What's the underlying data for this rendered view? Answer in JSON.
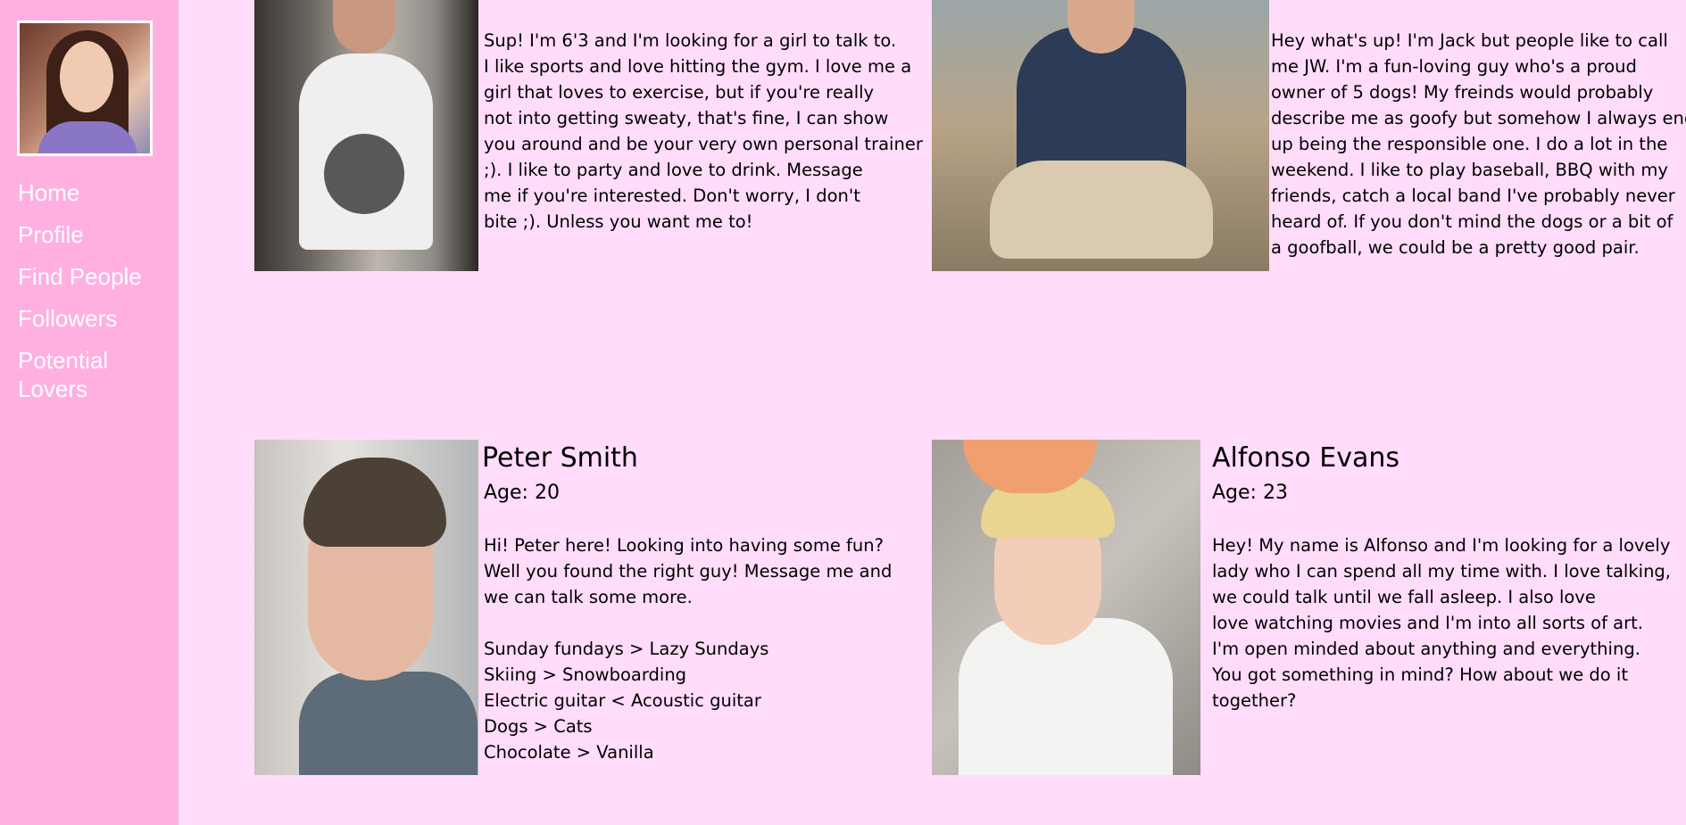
{
  "sidebar": {
    "avatar_icon": "profile-photo",
    "items": [
      {
        "label": "Home"
      },
      {
        "label": "Profile"
      },
      {
        "label": "Find People"
      },
      {
        "label": "Followers"
      },
      {
        "label": "Potential\nLovers"
      }
    ]
  },
  "profiles": [
    {
      "bio": "Sup! I'm 6'3 and I'm looking for a girl to talk to.\nI like sports and love hitting the gym. I love me a\ngirl that loves to exercise, but if you're really\nnot into getting sweaty, that's fine, I can show\nyou around and be your very own personal trainer\n;). I like to party and love to drink. Message\nme if you're interested. Don't worry, I don't\nbite ;). Unless you want me to!"
    },
    {
      "bio": "Hey what's up! I'm Jack but people like to call\nme JW. I'm a fun-loving guy who's a proud\nowner of 5 dogs! My freinds would probably\ndescribe me as goofy but somehow I always end\nup being the responsible one. I do a lot in the\nweekend. I like to play baseball, BBQ with my\nfriends, catch a local band I've probably never\nheard of. If you don't mind the dogs or a bit of\na goofball, we could be a pretty good pair."
    },
    {
      "name": "Peter Smith",
      "age": "Age: 20",
      "bio": "Hi! Peter here! Looking into having some fun?\nWell you found the right guy! Message me and\nwe can talk some more.\n\nSunday fundays > Lazy Sundays\nSkiing > Snowboarding\nElectric guitar < Acoustic guitar\nDogs > Cats\nChocolate > Vanilla"
    },
    {
      "name": "Alfonso Evans",
      "age": "Age: 23",
      "bio": "Hey! My name is Alfonso and I'm looking for a lovely\nlady who I can spend all my time with. I love talking,\nwe could talk until we fall asleep. I also love\nlove watching movies and I'm into all sorts of art.\nI'm open minded about anything and everything.\nYou got something in mind? How about we do it\ntogether?"
    }
  ],
  "colors": {
    "page_bg": "#ffdcfa",
    "sidebar_bg": "#ffb0e1",
    "nav_text": "#ffffff"
  }
}
